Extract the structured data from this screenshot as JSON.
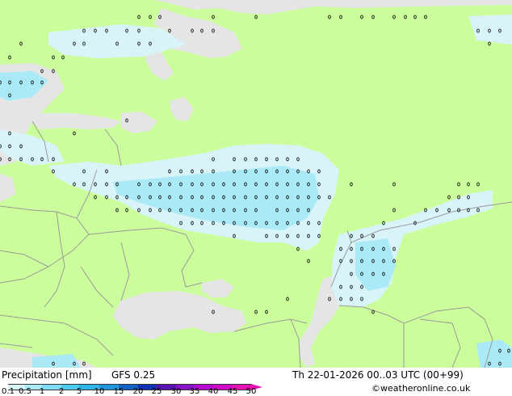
{
  "header": {
    "title": "Precipitation [mm]",
    "model": "GFS 0.25",
    "valid_time": "Th 22-01-2026 00..03 UTC (00+99)",
    "credit": "©weatheronline.co.uk"
  },
  "legend": {
    "tick_labels": [
      "0.1",
      "0.5",
      "1",
      "2",
      "5",
      "10",
      "15",
      "20",
      "25",
      "30",
      "35",
      "40",
      "45",
      "50"
    ],
    "colors": [
      "#d9f4f9",
      "#aaeaf6",
      "#7fdcf3",
      "#4fc8ef",
      "#2fb4e8",
      "#1e96dc",
      "#1464c8",
      "#1232b4",
      "#5a14b4",
      "#8c14c8",
      "#b40ad2",
      "#d20ac8",
      "#e614b4"
    ]
  },
  "map": {
    "land_color": "#ccfd9c",
    "sea_color": "#e5e5e5",
    "precip_light": "#d9f4f9",
    "precip_moderate": "#aaeaf6",
    "border_color": "#9a9a9a"
  }
}
